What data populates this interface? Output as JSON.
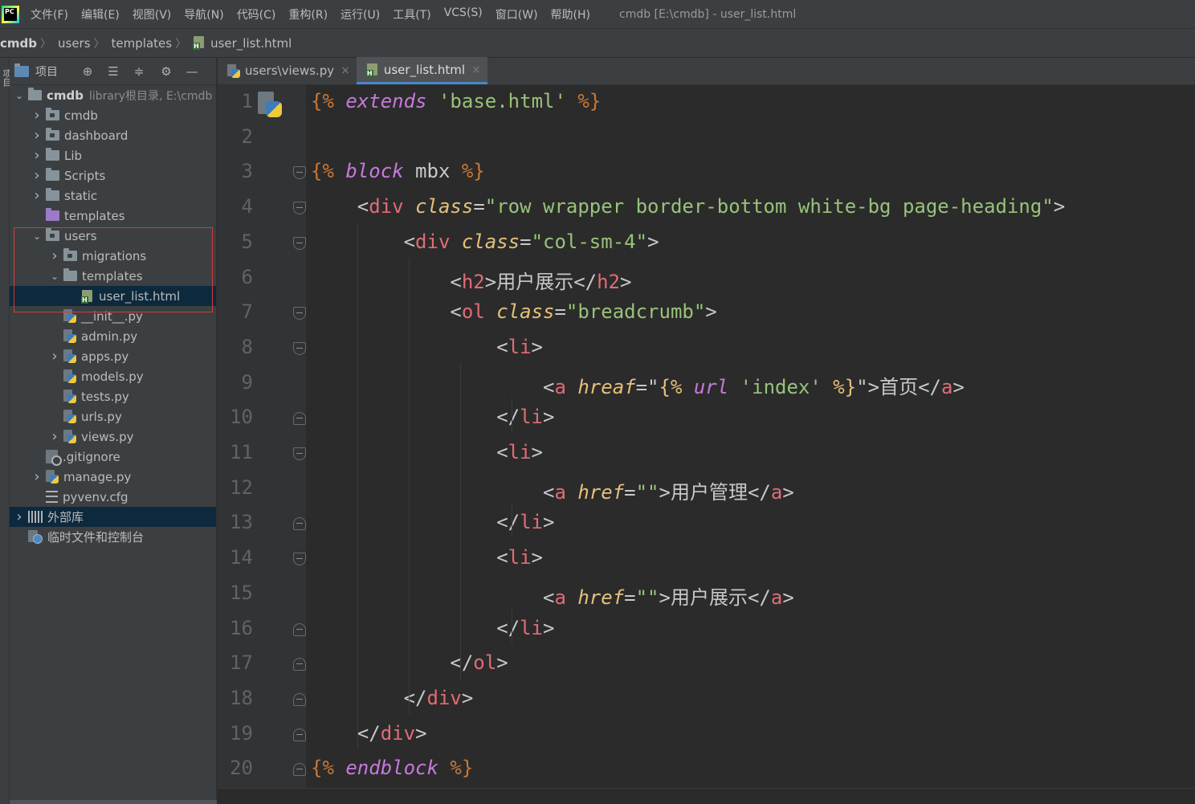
{
  "menu": {
    "items": [
      "文件(F)",
      "编辑(E)",
      "视图(V)",
      "导航(N)",
      "代码(C)",
      "重构(R)",
      "运行(U)",
      "工具(T)",
      "VCS(S)",
      "窗口(W)",
      "帮助(H)"
    ],
    "window_title": "cmdb [E:\\cmdb] - user_list.html",
    "logo_text": "PC"
  },
  "breadcrumb": [
    "cmdb",
    "users",
    "templates",
    "user_list.html"
  ],
  "left_strip": "项目",
  "project_panel": {
    "title": "项目",
    "tree": [
      {
        "label": "cmdb",
        "extra": "library根目录, E:\\cmdb",
        "icon": "folder",
        "arrow": "down",
        "indent": 0,
        "bold": true
      },
      {
        "label": "cmdb",
        "icon": "folder-dot",
        "arrow": "right",
        "indent": 1
      },
      {
        "label": "dashboard",
        "icon": "folder-dot",
        "arrow": "right",
        "indent": 1
      },
      {
        "label": "Lib",
        "icon": "folder",
        "arrow": "right",
        "indent": 1
      },
      {
        "label": "Scripts",
        "icon": "folder",
        "arrow": "right",
        "indent": 1
      },
      {
        "label": "static",
        "icon": "folder",
        "arrow": "right",
        "indent": 1
      },
      {
        "label": "templates",
        "icon": "folder-purple",
        "arrow": "",
        "indent": 1
      },
      {
        "label": "users",
        "icon": "folder-dot",
        "arrow": "down",
        "indent": 1
      },
      {
        "label": "migrations",
        "icon": "folder-dot",
        "arrow": "right",
        "indent": 2
      },
      {
        "label": "templates",
        "icon": "folder",
        "arrow": "down",
        "indent": 2
      },
      {
        "label": "user_list.html",
        "icon": "html",
        "arrow": "",
        "indent": 3,
        "selected": true
      },
      {
        "label": "__init__.py",
        "icon": "py",
        "arrow": "",
        "indent": 2
      },
      {
        "label": "admin.py",
        "icon": "py",
        "arrow": "",
        "indent": 2
      },
      {
        "label": "apps.py",
        "icon": "py",
        "arrow": "right",
        "indent": 2
      },
      {
        "label": "models.py",
        "icon": "py",
        "arrow": "",
        "indent": 2
      },
      {
        "label": "tests.py",
        "icon": "py",
        "arrow": "",
        "indent": 2
      },
      {
        "label": "urls.py",
        "icon": "py",
        "arrow": "",
        "indent": 2
      },
      {
        "label": "views.py",
        "icon": "py",
        "arrow": "right",
        "indent": 2
      },
      {
        "label": ".gitignore",
        "icon": "git",
        "arrow": "",
        "indent": 1
      },
      {
        "label": "manage.py",
        "icon": "py",
        "arrow": "right",
        "indent": 1
      },
      {
        "label": "pyvenv.cfg",
        "icon": "cfg",
        "arrow": "",
        "indent": 1
      },
      {
        "label": "外部库",
        "icon": "lib",
        "arrow": "right",
        "indent": 0,
        "dark": true
      },
      {
        "label": "临时文件和控制台",
        "icon": "tmp",
        "arrow": "",
        "indent": 0
      }
    ]
  },
  "tabs": [
    {
      "label": "users\\views.py",
      "icon": "py",
      "active": false
    },
    {
      "label": "user_list.html",
      "icon": "html",
      "active": true
    }
  ],
  "code_lines": [
    [
      [
        "k",
        "{% "
      ],
      [
        "kw",
        "extends"
      ],
      [
        "p",
        " "
      ],
      [
        "s",
        "'base.html'"
      ],
      [
        "k",
        " %}"
      ]
    ],
    [],
    [
      [
        "k",
        "{% "
      ],
      [
        "kw",
        "block"
      ],
      [
        "p",
        " mbx "
      ],
      [
        "k",
        "%}"
      ]
    ],
    [
      [
        "p",
        "    <"
      ],
      [
        "t",
        "div"
      ],
      [
        "p",
        " "
      ],
      [
        "a",
        "class"
      ],
      [
        "p",
        "="
      ],
      [
        "s",
        "\"row wrapper border-bottom white-bg page-heading\""
      ],
      [
        "p",
        ">"
      ]
    ],
    [
      [
        "p",
        "        <"
      ],
      [
        "t",
        "div"
      ],
      [
        "p",
        " "
      ],
      [
        "a",
        "class"
      ],
      [
        "p",
        "="
      ],
      [
        "s",
        "\"col-sm-4\""
      ],
      [
        "p",
        ">"
      ]
    ],
    [
      [
        "p",
        "            <"
      ],
      [
        "t",
        "h2"
      ],
      [
        "p",
        ">用户展示</"
      ],
      [
        "t",
        "h2"
      ],
      [
        "p",
        ">"
      ]
    ],
    [
      [
        "p",
        "            <"
      ],
      [
        "t",
        "ol"
      ],
      [
        "p",
        " "
      ],
      [
        "a",
        "class"
      ],
      [
        "p",
        "="
      ],
      [
        "s",
        "\"breadcrumb\""
      ],
      [
        "p",
        ">"
      ]
    ],
    [
      [
        "p",
        "                <"
      ],
      [
        "t",
        "li"
      ],
      [
        "p",
        ">"
      ]
    ],
    [
      [
        "p",
        "                    <"
      ],
      [
        "t",
        "a"
      ],
      [
        "p",
        " "
      ],
      [
        "a",
        "hreaf"
      ],
      [
        "p",
        "=\""
      ],
      [
        "b",
        "{%"
      ],
      [
        "p",
        " "
      ],
      [
        "kw",
        "url"
      ],
      [
        "p",
        " "
      ],
      [
        "s",
        "'index'"
      ],
      [
        "p",
        " "
      ],
      [
        "b",
        "%}"
      ],
      [
        "p",
        "\">首页</"
      ],
      [
        "t",
        "a"
      ],
      [
        "p",
        ">"
      ]
    ],
    [
      [
        "p",
        "                </"
      ],
      [
        "t",
        "li"
      ],
      [
        "p",
        ">"
      ]
    ],
    [
      [
        "p",
        "                <"
      ],
      [
        "t",
        "li"
      ],
      [
        "p",
        ">"
      ]
    ],
    [
      [
        "p",
        "                    <"
      ],
      [
        "t",
        "a"
      ],
      [
        "p",
        " "
      ],
      [
        "a",
        "href"
      ],
      [
        "p",
        "="
      ],
      [
        "s",
        "\"\""
      ],
      [
        "p",
        ">用户管理</"
      ],
      [
        "t",
        "a"
      ],
      [
        "p",
        ">"
      ]
    ],
    [
      [
        "p",
        "                </"
      ],
      [
        "t",
        "li"
      ],
      [
        "p",
        ">"
      ]
    ],
    [
      [
        "p",
        "                <"
      ],
      [
        "t",
        "li"
      ],
      [
        "p",
        ">"
      ]
    ],
    [
      [
        "p",
        "                    <"
      ],
      [
        "t",
        "a"
      ],
      [
        "p",
        " "
      ],
      [
        "a",
        "href"
      ],
      [
        "p",
        "="
      ],
      [
        "s",
        "\"\""
      ],
      [
        "p",
        ">用户展示</"
      ],
      [
        "t",
        "a"
      ],
      [
        "p",
        ">"
      ]
    ],
    [
      [
        "p",
        "                </"
      ],
      [
        "t",
        "li"
      ],
      [
        "p",
        ">"
      ]
    ],
    [
      [
        "p",
        "            </"
      ],
      [
        "t",
        "ol"
      ],
      [
        "p",
        ">"
      ]
    ],
    [
      [
        "p",
        "        </"
      ],
      [
        "t",
        "div"
      ],
      [
        "p",
        ">"
      ]
    ],
    [
      [
        "p",
        "    </"
      ],
      [
        "t",
        "div"
      ],
      [
        "p",
        ">"
      ]
    ],
    [
      [
        "k",
        "{% "
      ],
      [
        "kw",
        "endblock"
      ],
      [
        "p",
        " "
      ],
      [
        "k",
        "%}"
      ]
    ]
  ],
  "fold_markers": {
    "3": "open",
    "4": "open",
    "5": "open",
    "7": "open",
    "8": "open",
    "10": "close",
    "11": "open",
    "13": "close",
    "14": "open",
    "16": "close",
    "17": "close",
    "18": "close",
    "19": "close",
    "20": "close"
  }
}
